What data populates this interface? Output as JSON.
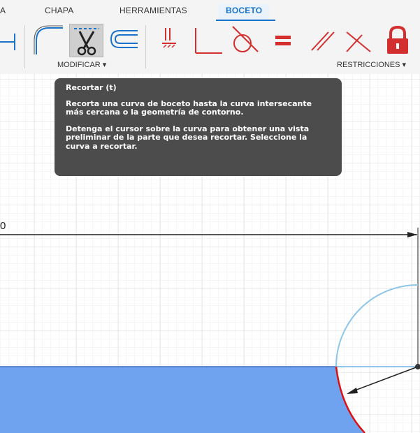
{
  "tabs": [
    {
      "label": "A",
      "active": false
    },
    {
      "label": "CHAPA",
      "active": false
    },
    {
      "label": "HERRAMIENTAS",
      "active": false
    },
    {
      "label": "BOCETO",
      "active": true
    }
  ],
  "ribbon": {
    "modificar_label": "MODIFICAR ▾",
    "restricciones_label": "RESTRICCIONES ▾"
  },
  "tooltip": {
    "title": "Recortar (t)",
    "line1": "Recorta una curva de boceto hasta la curva intersecante más cercana o la geometría de contorno.",
    "line2": "Detenga el cursor sobre la curva para obtener una vista preliminar de la parte que desea recortar. Seleccione la curva a recortar."
  },
  "canvas": {
    "dimension_value": "0"
  },
  "colors": {
    "accent": "#1a73c9",
    "profile_fill": "#6fa3f0",
    "sketch_curve": "#8cc6e8",
    "trim_preview": "#e01010",
    "tooltip_bg": "#4c4c4c",
    "constraint_red": "#d32f2f"
  }
}
